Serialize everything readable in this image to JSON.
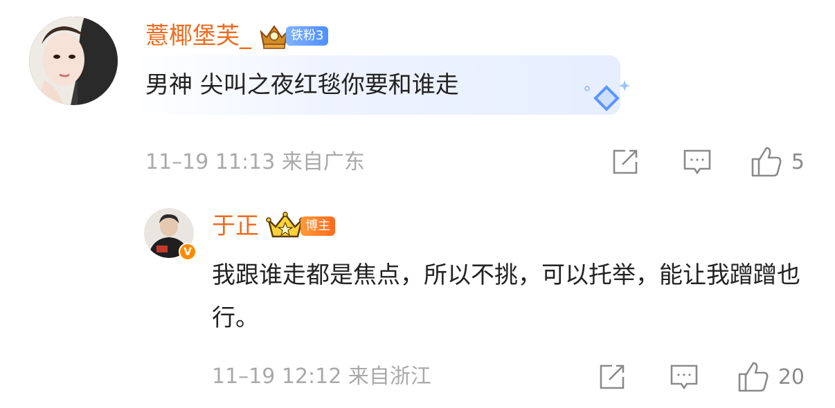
{
  "comments": [
    {
      "username": "薏椰堡芙_",
      "badge": "铁粉3",
      "text": "男神 尖叫之夜红毯你要和谁走",
      "time": "11–19 11:13",
      "location": "来自广东",
      "likes": "5"
    },
    {
      "username": "于正",
      "badge": "博主",
      "text": "我跟谁走都是焦点，所以不挑，可以托举，能让我蹭蹭也行。",
      "time": "11–19 12:12",
      "location": "来自浙江",
      "likes": "20"
    }
  ],
  "icons": {
    "share": "share-icon",
    "reply": "comment-icon",
    "like": "thumbs-up-icon",
    "crown": "crown-icon",
    "verified": "verified-v-icon"
  },
  "colors": {
    "username": "#f06b1d",
    "meta": "#a9a9a9",
    "fan_badge": "#5a95ff",
    "blogger_badge": "#ff7a22"
  }
}
